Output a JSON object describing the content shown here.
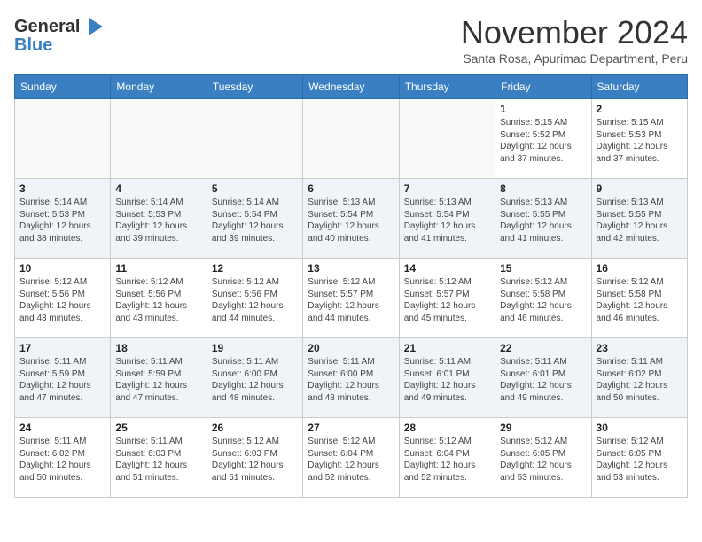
{
  "logo": {
    "line1": "General",
    "line2": "Blue",
    "icon": "▶"
  },
  "title": "November 2024",
  "subtitle": "Santa Rosa, Apurimac Department, Peru",
  "days_of_week": [
    "Sunday",
    "Monday",
    "Tuesday",
    "Wednesday",
    "Thursday",
    "Friday",
    "Saturday"
  ],
  "weeks": [
    [
      {
        "day": "",
        "info": ""
      },
      {
        "day": "",
        "info": ""
      },
      {
        "day": "",
        "info": ""
      },
      {
        "day": "",
        "info": ""
      },
      {
        "day": "",
        "info": ""
      },
      {
        "day": "1",
        "info": "Sunrise: 5:15 AM\nSunset: 5:52 PM\nDaylight: 12 hours\nand 37 minutes."
      },
      {
        "day": "2",
        "info": "Sunrise: 5:15 AM\nSunset: 5:53 PM\nDaylight: 12 hours\nand 37 minutes."
      }
    ],
    [
      {
        "day": "3",
        "info": "Sunrise: 5:14 AM\nSunset: 5:53 PM\nDaylight: 12 hours\nand 38 minutes."
      },
      {
        "day": "4",
        "info": "Sunrise: 5:14 AM\nSunset: 5:53 PM\nDaylight: 12 hours\nand 39 minutes."
      },
      {
        "day": "5",
        "info": "Sunrise: 5:14 AM\nSunset: 5:54 PM\nDaylight: 12 hours\nand 39 minutes."
      },
      {
        "day": "6",
        "info": "Sunrise: 5:13 AM\nSunset: 5:54 PM\nDaylight: 12 hours\nand 40 minutes."
      },
      {
        "day": "7",
        "info": "Sunrise: 5:13 AM\nSunset: 5:54 PM\nDaylight: 12 hours\nand 41 minutes."
      },
      {
        "day": "8",
        "info": "Sunrise: 5:13 AM\nSunset: 5:55 PM\nDaylight: 12 hours\nand 41 minutes."
      },
      {
        "day": "9",
        "info": "Sunrise: 5:13 AM\nSunset: 5:55 PM\nDaylight: 12 hours\nand 42 minutes."
      }
    ],
    [
      {
        "day": "10",
        "info": "Sunrise: 5:12 AM\nSunset: 5:56 PM\nDaylight: 12 hours\nand 43 minutes."
      },
      {
        "day": "11",
        "info": "Sunrise: 5:12 AM\nSunset: 5:56 PM\nDaylight: 12 hours\nand 43 minutes."
      },
      {
        "day": "12",
        "info": "Sunrise: 5:12 AM\nSunset: 5:56 PM\nDaylight: 12 hours\nand 44 minutes."
      },
      {
        "day": "13",
        "info": "Sunrise: 5:12 AM\nSunset: 5:57 PM\nDaylight: 12 hours\nand 44 minutes."
      },
      {
        "day": "14",
        "info": "Sunrise: 5:12 AM\nSunset: 5:57 PM\nDaylight: 12 hours\nand 45 minutes."
      },
      {
        "day": "15",
        "info": "Sunrise: 5:12 AM\nSunset: 5:58 PM\nDaylight: 12 hours\nand 46 minutes."
      },
      {
        "day": "16",
        "info": "Sunrise: 5:12 AM\nSunset: 5:58 PM\nDaylight: 12 hours\nand 46 minutes."
      }
    ],
    [
      {
        "day": "17",
        "info": "Sunrise: 5:11 AM\nSunset: 5:59 PM\nDaylight: 12 hours\nand 47 minutes."
      },
      {
        "day": "18",
        "info": "Sunrise: 5:11 AM\nSunset: 5:59 PM\nDaylight: 12 hours\nand 47 minutes."
      },
      {
        "day": "19",
        "info": "Sunrise: 5:11 AM\nSunset: 6:00 PM\nDaylight: 12 hours\nand 48 minutes."
      },
      {
        "day": "20",
        "info": "Sunrise: 5:11 AM\nSunset: 6:00 PM\nDaylight: 12 hours\nand 48 minutes."
      },
      {
        "day": "21",
        "info": "Sunrise: 5:11 AM\nSunset: 6:01 PM\nDaylight: 12 hours\nand 49 minutes."
      },
      {
        "day": "22",
        "info": "Sunrise: 5:11 AM\nSunset: 6:01 PM\nDaylight: 12 hours\nand 49 minutes."
      },
      {
        "day": "23",
        "info": "Sunrise: 5:11 AM\nSunset: 6:02 PM\nDaylight: 12 hours\nand 50 minutes."
      }
    ],
    [
      {
        "day": "24",
        "info": "Sunrise: 5:11 AM\nSunset: 6:02 PM\nDaylight: 12 hours\nand 50 minutes."
      },
      {
        "day": "25",
        "info": "Sunrise: 5:11 AM\nSunset: 6:03 PM\nDaylight: 12 hours\nand 51 minutes."
      },
      {
        "day": "26",
        "info": "Sunrise: 5:12 AM\nSunset: 6:03 PM\nDaylight: 12 hours\nand 51 minutes."
      },
      {
        "day": "27",
        "info": "Sunrise: 5:12 AM\nSunset: 6:04 PM\nDaylight: 12 hours\nand 52 minutes."
      },
      {
        "day": "28",
        "info": "Sunrise: 5:12 AM\nSunset: 6:04 PM\nDaylight: 12 hours\nand 52 minutes."
      },
      {
        "day": "29",
        "info": "Sunrise: 5:12 AM\nSunset: 6:05 PM\nDaylight: 12 hours\nand 53 minutes."
      },
      {
        "day": "30",
        "info": "Sunrise: 5:12 AM\nSunset: 6:05 PM\nDaylight: 12 hours\nand 53 minutes."
      }
    ]
  ]
}
